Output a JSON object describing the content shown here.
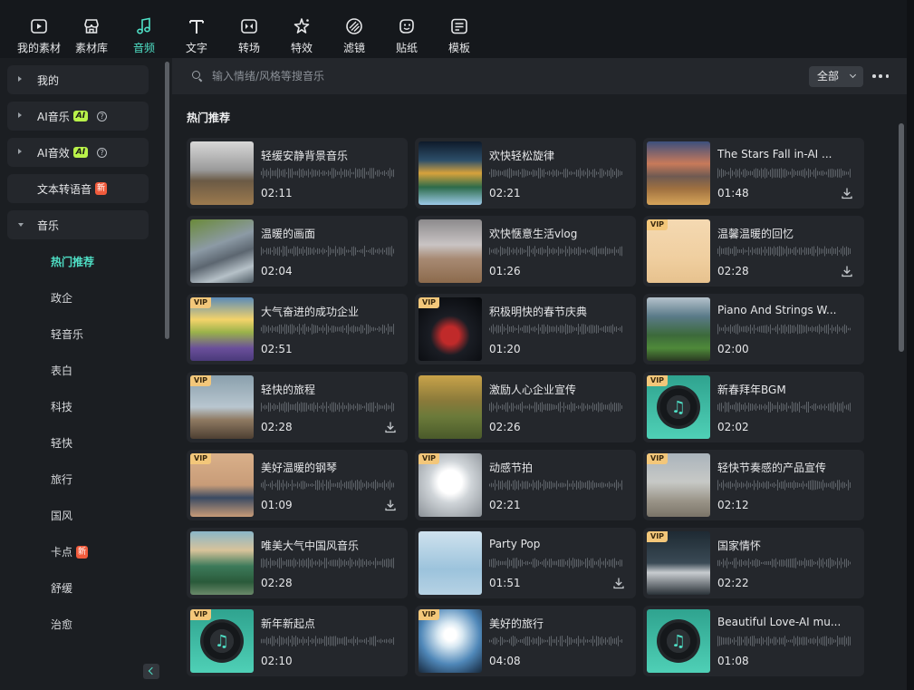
{
  "toolbar": [
    {
      "label": "我的素材",
      "icon": "play-box-icon"
    },
    {
      "label": "素材库",
      "icon": "store-icon"
    },
    {
      "label": "音频",
      "icon": "music-note-icon",
      "active": true
    },
    {
      "label": "文字",
      "icon": "text-icon"
    },
    {
      "label": "转场",
      "icon": "transition-icon"
    },
    {
      "label": "特效",
      "icon": "sparkle-icon"
    },
    {
      "label": "滤镜",
      "icon": "filter-icon"
    },
    {
      "label": "贴纸",
      "icon": "sticker-icon"
    },
    {
      "label": "模板",
      "icon": "template-icon"
    }
  ],
  "sidebar": {
    "groups": [
      {
        "label": "我的",
        "expanded": false
      },
      {
        "label": "AI音乐",
        "badge": "AI",
        "help": true,
        "expanded": false
      },
      {
        "label": "AI音效",
        "badge": "AI",
        "help": true,
        "expanded": false
      },
      {
        "label": "文本转语音",
        "new_badge": "新"
      },
      {
        "label": "音乐",
        "expanded": true
      }
    ],
    "music_items": [
      {
        "label": "热门推荐",
        "active": true
      },
      {
        "label": "政企"
      },
      {
        "label": "轻音乐"
      },
      {
        "label": "表白"
      },
      {
        "label": "科技"
      },
      {
        "label": "轻快"
      },
      {
        "label": "旅行"
      },
      {
        "label": "国风"
      },
      {
        "label": "卡点",
        "new_badge": "新"
      },
      {
        "label": "舒缓"
      },
      {
        "label": "治愈"
      }
    ]
  },
  "search": {
    "placeholder": "输入情绪/风格等搜音乐",
    "filter_value": "全部"
  },
  "section_title": "热门推荐",
  "tracks": [
    {
      "title": "轻缓安静背景音乐",
      "duration": "02:11",
      "vip": false,
      "download": false,
      "thumb": "guitar-field"
    },
    {
      "title": "欢快轻松旋律",
      "duration": "02:21",
      "vip": false,
      "download": false,
      "thumb": "collage-lake"
    },
    {
      "title": "The Stars Fall in-AI ...",
      "duration": "01:48",
      "vip": false,
      "download": true,
      "thumb": "mountain-sunset"
    },
    {
      "title": "温暖的画面",
      "duration": "02:04",
      "vip": false,
      "download": false,
      "thumb": "river-rocks"
    },
    {
      "title": "欢快惬意生活vlog",
      "duration": "01:26",
      "vip": false,
      "download": false,
      "thumb": "storm-plain"
    },
    {
      "title": "温馨温暖的回忆",
      "duration": "02:28",
      "vip": true,
      "download": true,
      "thumb": "cafe-cups"
    },
    {
      "title": "大气奋进的成功企业",
      "duration": "02:51",
      "vip": true,
      "download": false,
      "thumb": "lavender-sunrise"
    },
    {
      "title": "积极明快的春节庆典",
      "duration": "01:20",
      "vip": true,
      "download": false,
      "thumb": "cherries-splash"
    },
    {
      "title": "Piano And Strings W...",
      "duration": "02:00",
      "vip": false,
      "download": false,
      "thumb": "green-valley"
    },
    {
      "title": "轻快的旅程",
      "duration": "02:28",
      "vip": true,
      "download": true,
      "thumb": "seagull-rock"
    },
    {
      "title": "激励人心企业宣传",
      "duration": "02:26",
      "vip": false,
      "download": false,
      "thumb": "golden-path"
    },
    {
      "title": "新春拜年BGM",
      "duration": "02:02",
      "vip": true,
      "download": false,
      "thumb": "music-disc"
    },
    {
      "title": "美好温暖的钢琴",
      "duration": "01:09",
      "vip": true,
      "download": true,
      "thumb": "flatlay-clothes"
    },
    {
      "title": "动感节拍",
      "duration": "02:21",
      "vip": true,
      "download": false,
      "thumb": "tunnel-people"
    },
    {
      "title": "轻快节奏感的产品宣传",
      "duration": "02:12",
      "vip": true,
      "download": false,
      "thumb": "beach-ball"
    },
    {
      "title": "唯美大气中国风音乐",
      "duration": "02:28",
      "vip": false,
      "download": false,
      "thumb": "chinese-mountains"
    },
    {
      "title": "Party Pop",
      "duration": "01:51",
      "vip": false,
      "download": true,
      "thumb": "birds-sky"
    },
    {
      "title": "国家情怀",
      "duration": "02:22",
      "vip": true,
      "download": false,
      "thumb": "gull-closeup"
    },
    {
      "title": "新年新起点",
      "duration": "02:10",
      "vip": true,
      "download": false,
      "thumb": "music-disc"
    },
    {
      "title": "美好的旅行",
      "duration": "04:08",
      "vip": true,
      "download": false,
      "thumb": "sun-clouds"
    },
    {
      "title": "Beautiful Love-AI mu...",
      "duration": "01:08",
      "vip": false,
      "download": false,
      "thumb": "music-disc"
    }
  ],
  "vip_label": "VIP",
  "colors": {
    "accent": "#4fe0c6",
    "vip": "#f3c77a",
    "new_badge": "#f05b3c",
    "ai_badge": "#b9f24a"
  }
}
